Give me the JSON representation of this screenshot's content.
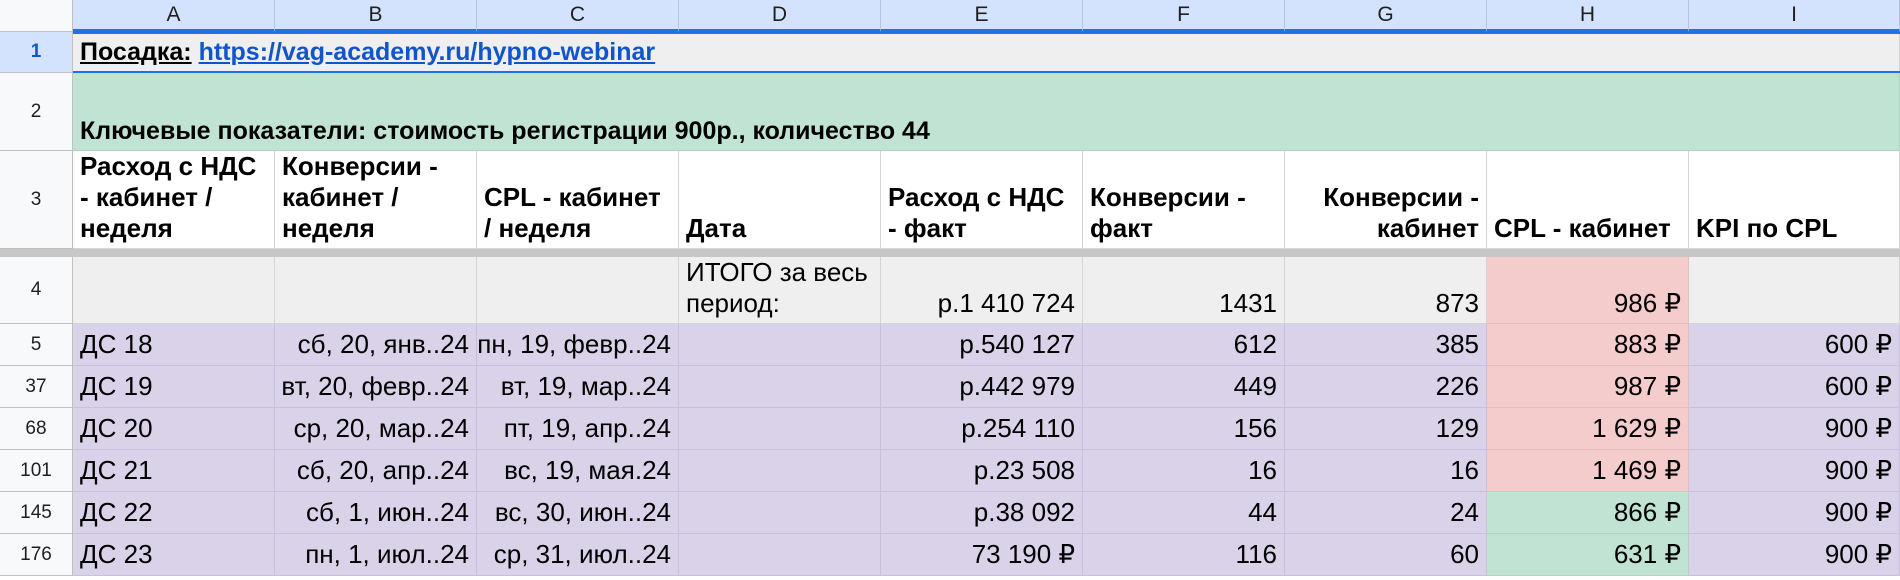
{
  "columns": [
    "A",
    "B",
    "C",
    "D",
    "E",
    "F",
    "G",
    "H",
    "I"
  ],
  "row_numbers": [
    "1",
    "2",
    "3",
    "4",
    "5",
    "37",
    "68",
    "101",
    "145",
    "176"
  ],
  "row1": {
    "label": "Посадка:",
    "link": "https://vag-academy.ru/hypno-webinar"
  },
  "row2": {
    "text": "Ключевые показатели: стоимость регистрации 900р., количество 44"
  },
  "headers": {
    "a": "Расход с НДС - кабинет / неделя",
    "b": "Конверсии - кабинет / неделя",
    "c": "CPL - кабинет / неделя",
    "d": "Дата",
    "e": "Расход с НДС - факт",
    "f": "Конверсии - факт",
    "g": "Конверсии - кабинет",
    "h": "CPL - кабинет",
    "i": "KPI по CPL"
  },
  "totals": {
    "label": "ИТОГО за весь период:",
    "spend": "р.1 410 724",
    "conv_fact": "1431",
    "conv_cab": "873",
    "cpl": "986 ₽"
  },
  "rows": [
    {
      "a": "ДС 18",
      "b": "сб, 20, янв..24",
      "c": "пн, 19, февр..24",
      "e": "р.540 127",
      "f": "612",
      "g": "385",
      "h": "883 ₽",
      "i": "600 ₽"
    },
    {
      "a": "ДС 19",
      "b": "вт, 20, февр..24",
      "c": "вт, 19, мар..24",
      "e": "р.442 979",
      "f": "449",
      "g": "226",
      "h": "987 ₽",
      "i": "600 ₽"
    },
    {
      "a": "ДС 20",
      "b": "ср, 20, мар..24",
      "c": "пт, 19, апр..24",
      "e": "р.254 110",
      "f": "156",
      "g": "129",
      "h": "1 629 ₽",
      "i": "900 ₽"
    },
    {
      "a": "ДС 21",
      "b": "сб, 20, апр..24",
      "c": "вс, 19, мая.24",
      "e": "р.23 508",
      "f": "16",
      "g": "16",
      "h": "1 469 ₽",
      "i": "900 ₽"
    },
    {
      "a": "ДС 22",
      "b": "сб, 1, июн..24",
      "c": "вс, 30, июн..24",
      "e": "р.38 092",
      "f": "44",
      "g": "24",
      "h": "866 ₽",
      "i": "900 ₽"
    },
    {
      "a": "ДС 23",
      "b": "пн, 1, июл..24",
      "c": "ср, 31, июл..24",
      "e": "73 190 ₽",
      "f": "116",
      "g": "60",
      "h": "631 ₽",
      "i": "900 ₽"
    }
  ],
  "colors": {
    "purple": "#d9d2e9",
    "red": "#f4cccc",
    "green": "#c1e3d3",
    "header_blue": "#d3e3fd",
    "link": "#1155cc"
  }
}
